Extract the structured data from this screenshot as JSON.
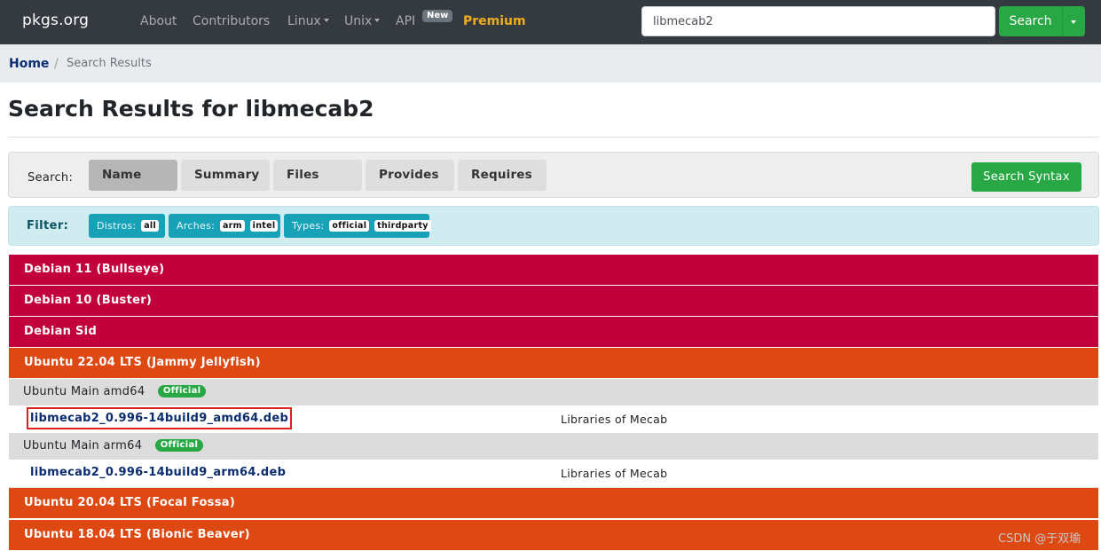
{
  "navbar": {
    "brand": "pkgs.org",
    "items": [
      {
        "label": "About"
      },
      {
        "label": "Contributors"
      },
      {
        "label": "Linux"
      },
      {
        "label": "Unix"
      },
      {
        "label": "API"
      },
      {
        "label": "Premium"
      }
    ],
    "api_badge": "New",
    "search_value": "libmecab2",
    "search_button": "Search"
  },
  "breadcrumb": {
    "home": "Home",
    "separator": "/",
    "current": "Search Results"
  },
  "page": {
    "title": "Search Results for libmecab2"
  },
  "search_panel": {
    "label": "Search:",
    "tabs": [
      {
        "label": "Name",
        "active": true
      },
      {
        "label": "Summary",
        "active": false
      },
      {
        "label": "Files",
        "active": false
      },
      {
        "label": "Provides",
        "active": false
      },
      {
        "label": "Requires",
        "active": false
      }
    ],
    "syntax_button": "Search Syntax"
  },
  "filter_panel": {
    "label": "Filter:",
    "groups": [
      {
        "label": "Distros:",
        "values": [
          "all"
        ]
      },
      {
        "label": "Arches:",
        "values": [
          "arm",
          "intel"
        ]
      },
      {
        "label": "Types:",
        "values": [
          "official",
          "thirdparty"
        ]
      }
    ]
  },
  "results": {
    "distros": [
      {
        "name": "Debian 11 (Bullseye)",
        "family": "debian"
      },
      {
        "name": "Debian 10 (Buster)",
        "family": "debian"
      },
      {
        "name": "Debian Sid",
        "family": "debian"
      },
      {
        "name": "Ubuntu 22.04 LTS (Jammy Jellyfish)",
        "family": "ubuntu"
      },
      {
        "name": "Ubuntu 20.04 LTS (Focal Fossa)",
        "family": "ubuntu"
      },
      {
        "name": "Ubuntu 18.04 LTS (Bionic Beaver)",
        "family": "ubuntu"
      }
    ],
    "repos": [
      {
        "name": "Ubuntu Main amd64",
        "badge": "Official",
        "package": "libmecab2_0.996-14build9_amd64.deb",
        "description": "Libraries of Mecab"
      },
      {
        "name": "Ubuntu Main arm64",
        "badge": "Official",
        "package": "libmecab2_0.996-14build9_arm64.deb",
        "description": "Libraries of Mecab"
      }
    ]
  },
  "watermark": "CSDN @于双瑜",
  "colors": {
    "navbar": "#343a40",
    "green": "#28a745",
    "debian": "#c1003c",
    "ubuntu": "#dd4813",
    "premium": "#f0ad1e",
    "link": "#0b2d6e"
  }
}
